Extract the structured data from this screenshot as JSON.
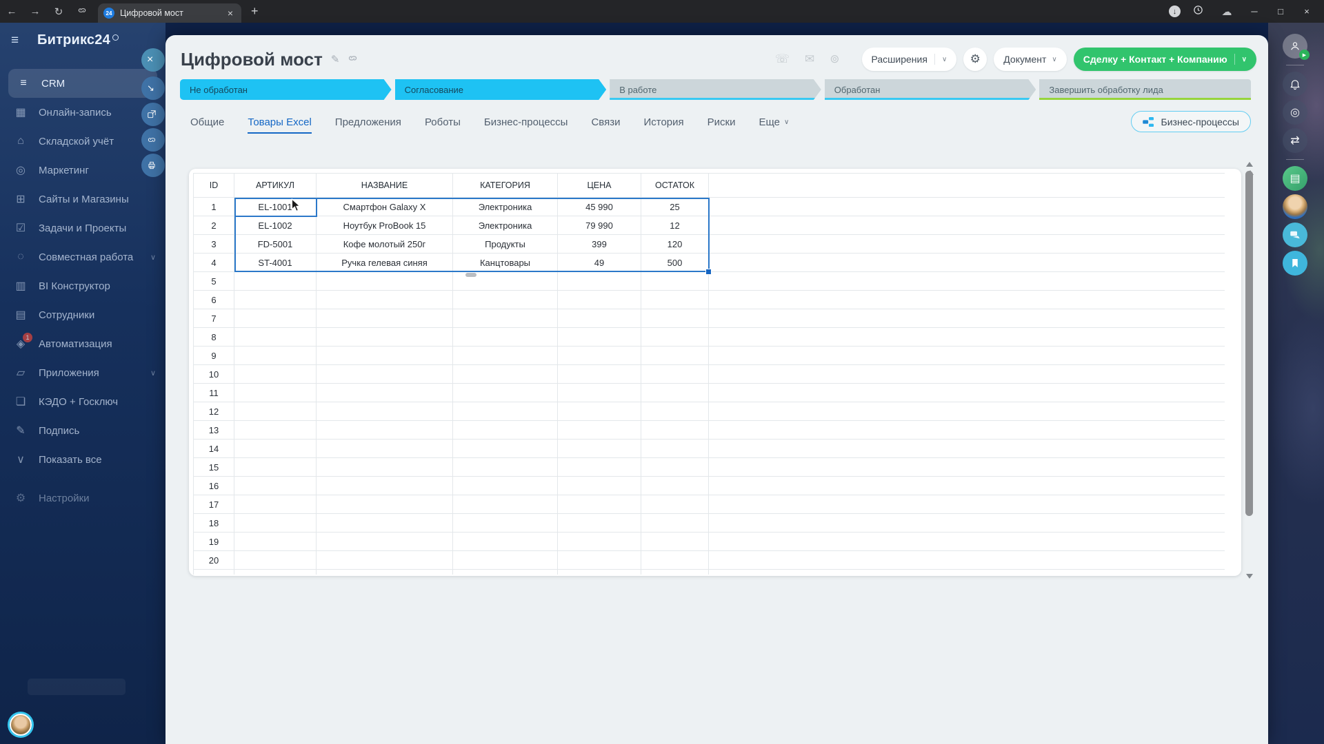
{
  "browser": {
    "tab_title": "Цифровой мост",
    "favicon_text": "24"
  },
  "sidebar": {
    "logo": "Битрикс24",
    "items": [
      {
        "label": "CRM",
        "icon": "crm-icon",
        "active": true
      },
      {
        "label": "Онлайн-запись",
        "icon": "calendar-icon"
      },
      {
        "label": "Складской учёт",
        "icon": "warehouse-icon"
      },
      {
        "label": "Маркетинг",
        "icon": "marketing-icon"
      },
      {
        "label": "Сайты и Магазины",
        "icon": "cart-icon"
      },
      {
        "label": "Задачи и Проекты",
        "icon": "tasks-icon"
      },
      {
        "label": "Совместная работа",
        "icon": "collab-icon",
        "chevron": true
      },
      {
        "label": "BI Конструктор",
        "icon": "bi-icon"
      },
      {
        "label": "Сотрудники",
        "icon": "employees-icon"
      },
      {
        "label": "Автоматизация",
        "icon": "automation-icon",
        "badge": "1"
      },
      {
        "label": "Приложения",
        "icon": "apps-icon",
        "chevron": true
      },
      {
        "label": "КЭДО + Госключ",
        "icon": "doc-icon"
      },
      {
        "label": "Подпись",
        "icon": "sign-icon"
      },
      {
        "label": "Показать все",
        "icon": "chevron-down-icon"
      },
      {
        "label": "Настройки",
        "icon": "gear-icon",
        "dim": true,
        "gap_top": true
      }
    ]
  },
  "panel_edge_buttons": [
    "close",
    "collapse",
    "open-new-window",
    "copy-link",
    "print"
  ],
  "header": {
    "title": "Цифровой мост",
    "extensions_button": "Расширения",
    "document_button": "Документ",
    "create_button": "Сделку + Контакт + Компанию"
  },
  "pipeline": {
    "stages": [
      {
        "label": "Не обработан",
        "state": "filled"
      },
      {
        "label": "Согласование",
        "state": "filled"
      },
      {
        "label": "В работе",
        "state": "pending"
      },
      {
        "label": "Обработан",
        "state": "pending"
      },
      {
        "label": "Завершить обработку лида",
        "state": "final"
      }
    ]
  },
  "tabs": {
    "items": [
      {
        "label": "Общие"
      },
      {
        "label": "Товары Excel",
        "active": true
      },
      {
        "label": "Предложения"
      },
      {
        "label": "Роботы"
      },
      {
        "label": "Бизнес-процессы"
      },
      {
        "label": "Связи"
      },
      {
        "label": "История"
      },
      {
        "label": "Риски"
      },
      {
        "label": "Еще",
        "chevron": true
      }
    ],
    "bp_button": "Бизнес-процессы"
  },
  "spreadsheet": {
    "columns": [
      "ID",
      "АРТИКУЛ",
      "НАЗВАНИЕ",
      "КАТЕГОРИЯ",
      "ЦЕНА",
      "ОСТАТОК"
    ],
    "rows": [
      {
        "id": "1",
        "sku": "EL-1001",
        "name": "Смартфон Galaxy X",
        "category": "Электроника",
        "price": "45 990",
        "stock": "25"
      },
      {
        "id": "2",
        "sku": "EL-1002",
        "name": "Ноутбук ProBook 15",
        "category": "Электроника",
        "price": "79 990",
        "stock": "12"
      },
      {
        "id": "3",
        "sku": "FD-5001",
        "name": "Кофе молотый 250г",
        "category": "Продукты",
        "price": "399",
        "stock": "120"
      },
      {
        "id": "4",
        "sku": "ST-4001",
        "name": "Ручка гелевая синяя",
        "category": "Канцтовары",
        "price": "49",
        "stock": "500"
      }
    ],
    "visible_row_count": 21,
    "selection": {
      "range": "B1:F4",
      "active_cell": "B1",
      "active_value": "EL-1001"
    }
  },
  "right_rail": [
    "profile",
    "notifications",
    "copilot",
    "messenger",
    "tasks-note",
    "support-avatar",
    "chat",
    "bookmark"
  ],
  "colors": {
    "stage_cyan": "#1ec2f3",
    "stage_green_underline": "#96d53c",
    "create_green": "#31c46d",
    "active_tab_blue": "#1467c5",
    "selection_blue": "#2b78c9",
    "sidebar_navy": "#16305c"
  }
}
